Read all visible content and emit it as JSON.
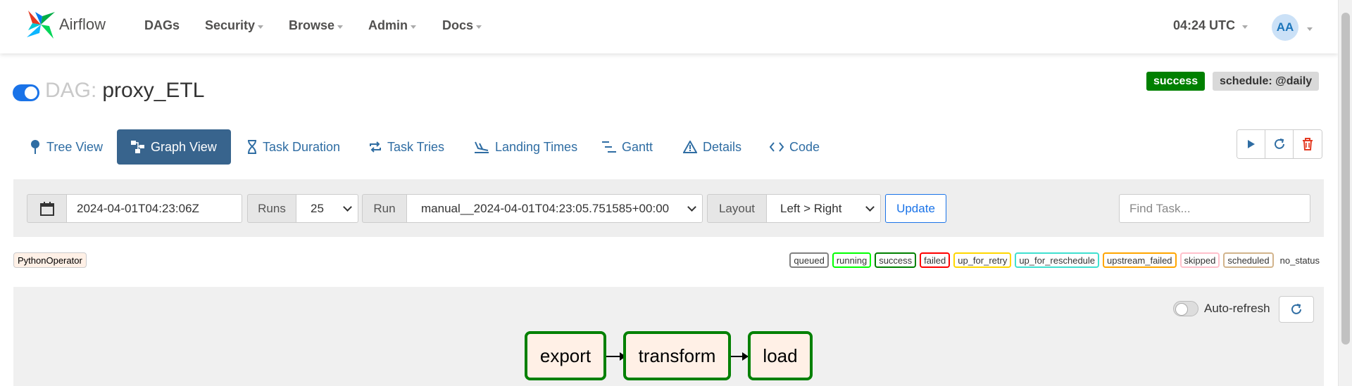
{
  "navbar": {
    "brand": "Airflow",
    "items": [
      {
        "label": "DAGs",
        "dropdown": false
      },
      {
        "label": "Security",
        "dropdown": true
      },
      {
        "label": "Browse",
        "dropdown": true
      },
      {
        "label": "Admin",
        "dropdown": true
      },
      {
        "label": "Docs",
        "dropdown": true
      }
    ],
    "clock": "04:24 UTC",
    "avatar_initials": "AA"
  },
  "dag": {
    "prefix": "DAG:",
    "name": "proxy_ETL",
    "status_badge": "success",
    "schedule_badge": "schedule: @daily",
    "paused": false
  },
  "tabs": [
    {
      "label": "Tree View",
      "icon": "tree-icon",
      "active": false
    },
    {
      "label": "Graph View",
      "icon": "graph-icon",
      "active": true
    },
    {
      "label": "Task Duration",
      "icon": "hourglass-icon",
      "active": false
    },
    {
      "label": "Task Tries",
      "icon": "repeat-icon",
      "active": false
    },
    {
      "label": "Landing Times",
      "icon": "landing-icon",
      "active": false
    },
    {
      "label": "Gantt",
      "icon": "gantt-icon",
      "active": false
    },
    {
      "label": "Details",
      "icon": "warning-triangle-icon",
      "active": false
    },
    {
      "label": "Code",
      "icon": "code-icon",
      "active": false
    }
  ],
  "filters": {
    "base_date": "2024-04-01T04:23:06Z",
    "runs_label": "Runs",
    "runs_value": "25",
    "run_label": "Run",
    "run_value": "manual__2024-04-01T04:23:05.751585+00:00",
    "layout_label": "Layout",
    "layout_value": "Left > Right",
    "update_label": "Update",
    "find_placeholder": "Find Task..."
  },
  "legend": {
    "operator": "PythonOperator",
    "operator_color": "#fff0e6",
    "statuses": [
      {
        "label": "queued",
        "color": "#808080"
      },
      {
        "label": "running",
        "color": "#00ff00"
      },
      {
        "label": "success",
        "color": "#008000"
      },
      {
        "label": "failed",
        "color": "#ff0000"
      },
      {
        "label": "up_for_retry",
        "color": "#ffd700"
      },
      {
        "label": "up_for_reschedule",
        "color": "#40e0d0"
      },
      {
        "label": "upstream_failed",
        "color": "#ffa500"
      },
      {
        "label": "skipped",
        "color": "#ffc0cb"
      },
      {
        "label": "scheduled",
        "color": "#d2b48c"
      },
      {
        "label": "no_status",
        "color": "none"
      }
    ]
  },
  "graph": {
    "auto_refresh_label": "Auto-refresh",
    "auto_refresh_on": false,
    "tasks": [
      {
        "name": "export",
        "state": "success"
      },
      {
        "name": "transform",
        "state": "success"
      },
      {
        "name": "load",
        "state": "success"
      }
    ]
  }
}
